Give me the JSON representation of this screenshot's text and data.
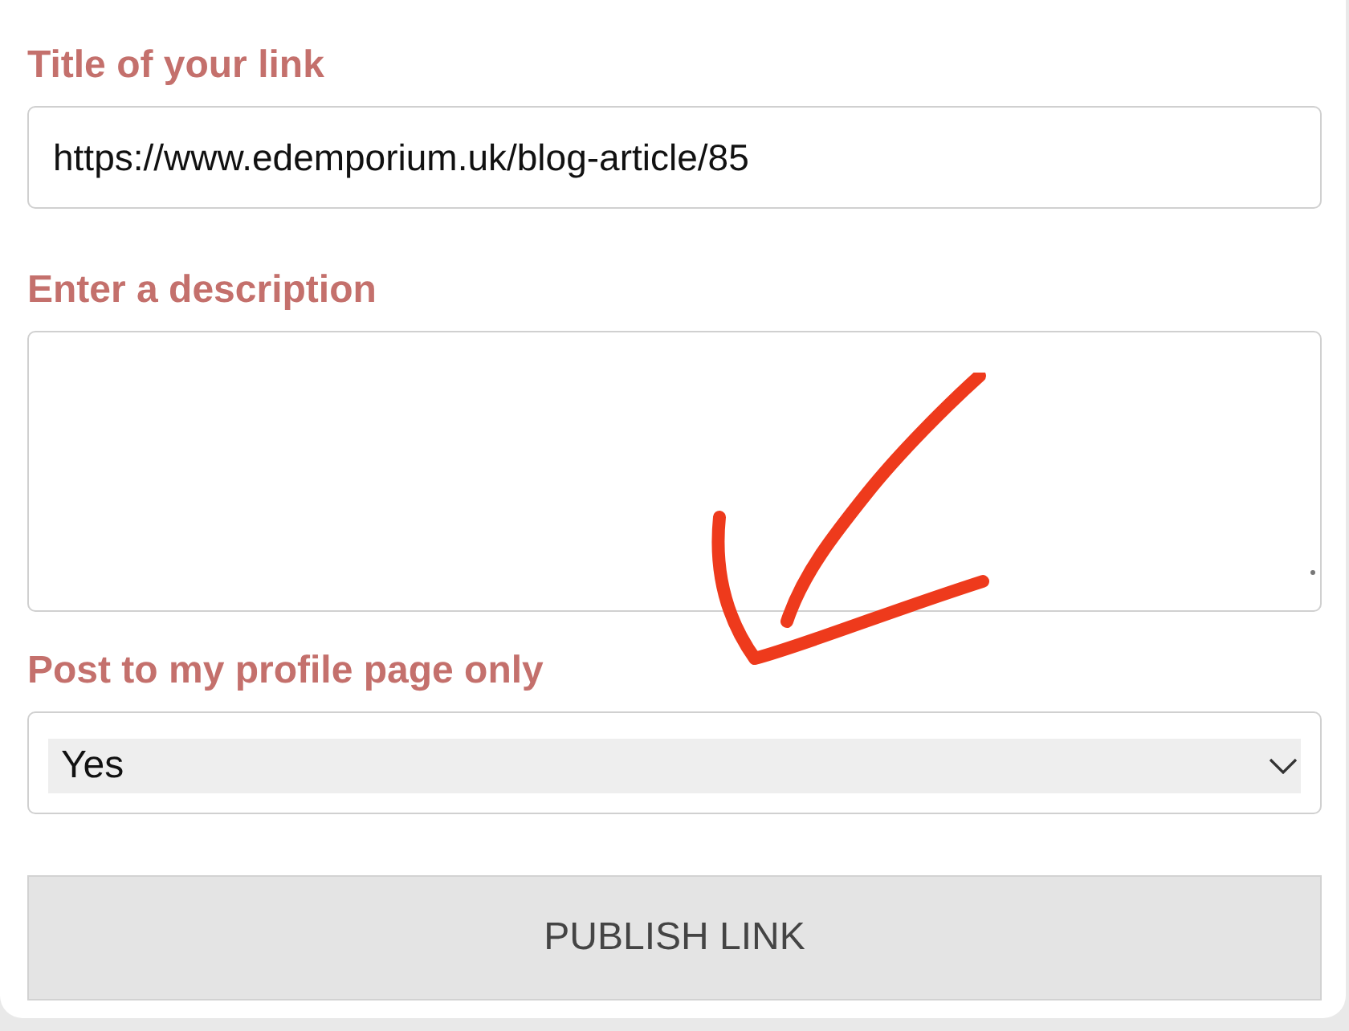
{
  "form": {
    "fields": [
      {
        "kind": "input",
        "label": "Title of your link",
        "value": "https://www.edemporium.uk/blog-article/85"
      },
      {
        "kind": "textarea",
        "label": "Enter a description"
      },
      {
        "kind": "select",
        "label": "Post to my profile page only",
        "value": "Yes"
      }
    ],
    "button": "PUBLISH LINK"
  }
}
